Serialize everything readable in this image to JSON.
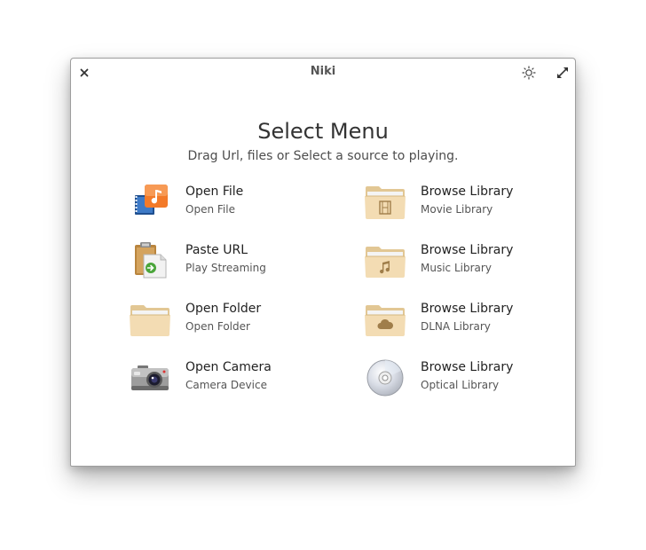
{
  "window": {
    "title": "Niki"
  },
  "main": {
    "heading": "Select Menu",
    "subheading": "Drag Url, files or Select a source to playing.",
    "left_items": [
      {
        "label": "Open File",
        "sub": "Open File",
        "icon": "music-file-icon"
      },
      {
        "label": "Paste URL",
        "sub": "Play Streaming",
        "icon": "clipboard-icon"
      },
      {
        "label": "Open Folder",
        "sub": "Open Folder",
        "icon": "folder-icon"
      },
      {
        "label": "Open Camera",
        "sub": "Camera Device",
        "icon": "camera-icon"
      }
    ],
    "right_items": [
      {
        "label": "Browse Library",
        "sub": "Movie Library",
        "icon": "video-folder-icon"
      },
      {
        "label": "Browse Library",
        "sub": "Music Library",
        "icon": "music-folder-icon"
      },
      {
        "label": "Browse Library",
        "sub": "DLNA Library",
        "icon": "cloud-folder-icon"
      },
      {
        "label": "Browse Library",
        "sub": "Optical Library",
        "icon": "optical-disc-icon"
      }
    ]
  },
  "colors": {
    "folder_tan": "#f1dcb6",
    "accent_orange": "#f37a29"
  }
}
